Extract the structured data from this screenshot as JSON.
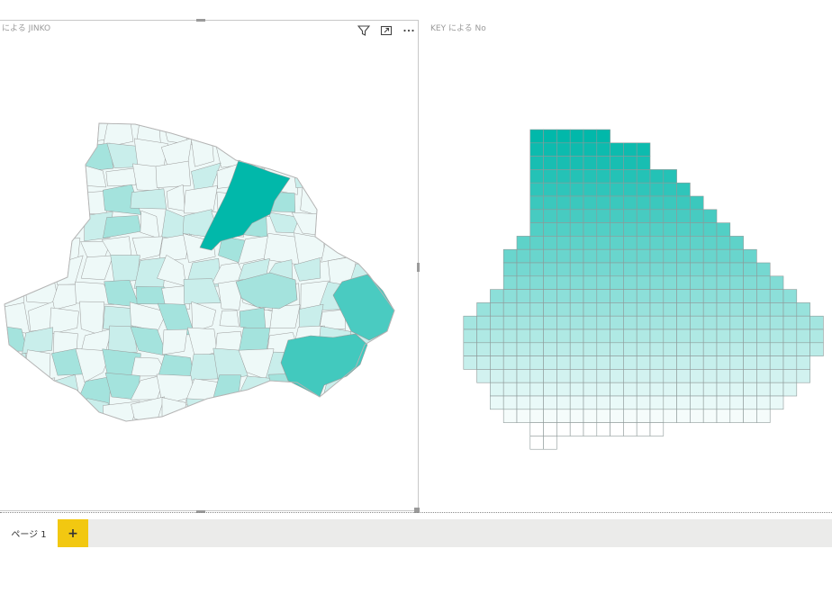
{
  "map_visual": {
    "title": "による JINKO",
    "icons": [
      "filter-icon",
      "focus-mode-icon",
      "more-options-icon"
    ],
    "colors": {
      "min": "#eef9f8",
      "mid": "#a4e3dd",
      "max": "#01b8aa",
      "border": "#9a9a9a"
    }
  },
  "grid_visual": {
    "title": "KEY による No",
    "colors": {
      "top": "#01b8aa",
      "bottom": "#ffffff",
      "border": "#8e9a99"
    }
  },
  "page_tabs": {
    "pages": [
      {
        "label": "ページ 1"
      }
    ],
    "add_label": "+"
  }
}
